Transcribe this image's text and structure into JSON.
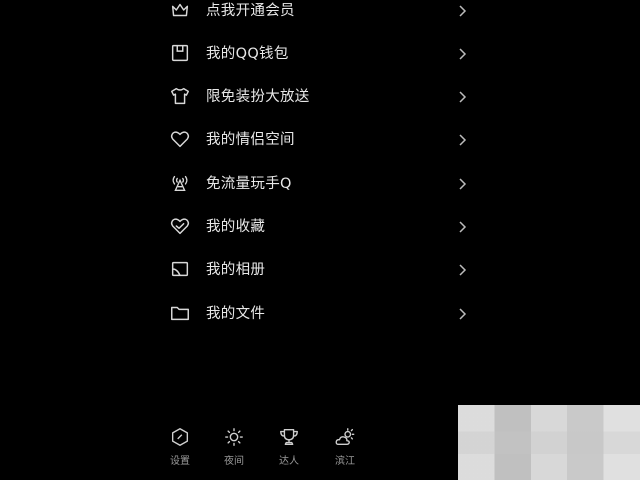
{
  "menu": {
    "items": [
      {
        "label": "点我开通会员",
        "icon": "crown-icon"
      },
      {
        "label": "我的QQ钱包",
        "icon": "wallet-icon"
      },
      {
        "label": "限免装扮大放送",
        "icon": "tshirt-icon"
      },
      {
        "label": "我的情侣空间",
        "icon": "heart-icon"
      },
      {
        "label": "免流量玩手Q",
        "icon": "signal-tower-icon"
      },
      {
        "label": "我的收藏",
        "icon": "heart-check-icon"
      },
      {
        "label": "我的相册",
        "icon": "album-icon"
      },
      {
        "label": "我的文件",
        "icon": "folder-icon"
      }
    ]
  },
  "bottom_bar": {
    "settings_label": "设置",
    "night_label": "夜间",
    "master_label": "达人",
    "weather_label": "滨江"
  },
  "colors": {
    "background": "#000000",
    "text": "#e8e8e8",
    "icon": "#d8d8d8",
    "secondary_text": "#9a9a9a"
  }
}
